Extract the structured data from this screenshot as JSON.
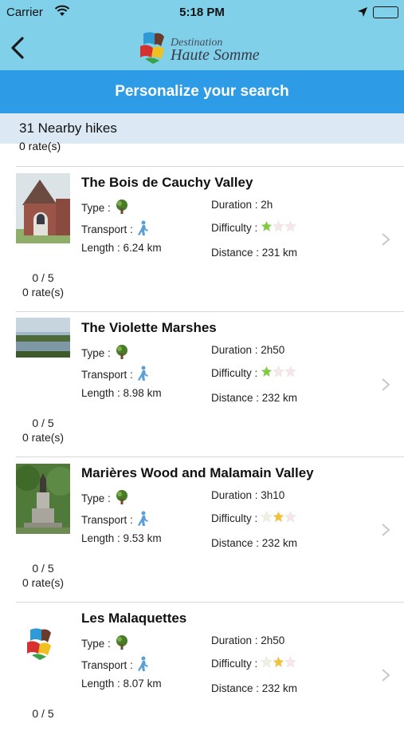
{
  "status_bar": {
    "carrier": "Carrier",
    "time": "5:18 PM"
  },
  "nav": {
    "brand_line1": "Destination",
    "brand_line2": "Haute Somme"
  },
  "header": {
    "title": "Personalize your search"
  },
  "results": {
    "count_label": "31 Nearby hikes",
    "partial_rate": "0 rate(s)"
  },
  "labels": {
    "type": "Type :",
    "transport": "Transport :",
    "difficulty": "Difficulty :"
  },
  "colors": {
    "status_bg": "#7fd0e8",
    "banner": "#2d9be6",
    "count_bg": "#dce9f5",
    "star_on": "#7ccf3a",
    "star_gold": "#f2c230",
    "star_off": "#f5e8ea"
  },
  "hikes": [
    {
      "title": "The Bois de Cauchy Valley",
      "length": "Length : 6.24 km",
      "duration": "Duration : 2h",
      "distance": "Distance : 231 km",
      "difficulty": 1,
      "score": "0 / 5",
      "rates": "0 rate(s)",
      "thumb": "church-photo"
    },
    {
      "title": "The Violette Marshes",
      "length": "Length : 8.98 km",
      "duration": "Duration : 2h50",
      "distance": "Distance : 232 km",
      "difficulty": 1,
      "score": "0 / 5",
      "rates": "0 rate(s)",
      "thumb": "marsh-photo"
    },
    {
      "title": "Marières Wood and Malamain Valley",
      "length": "Length : 9.53 km",
      "duration": "Duration : 3h10",
      "distance": "Distance : 232 km",
      "difficulty": 2,
      "score": "0 / 5",
      "rates": "0 rate(s)",
      "thumb": "monument-photo"
    },
    {
      "title": "Les Malaquettes",
      "length": "Length : 8.07 km",
      "duration": "Duration : 2h50",
      "distance": "Distance : 232 km",
      "difficulty": 2,
      "score": "0 / 5",
      "rates": "",
      "thumb": "logo-placeholder"
    }
  ]
}
